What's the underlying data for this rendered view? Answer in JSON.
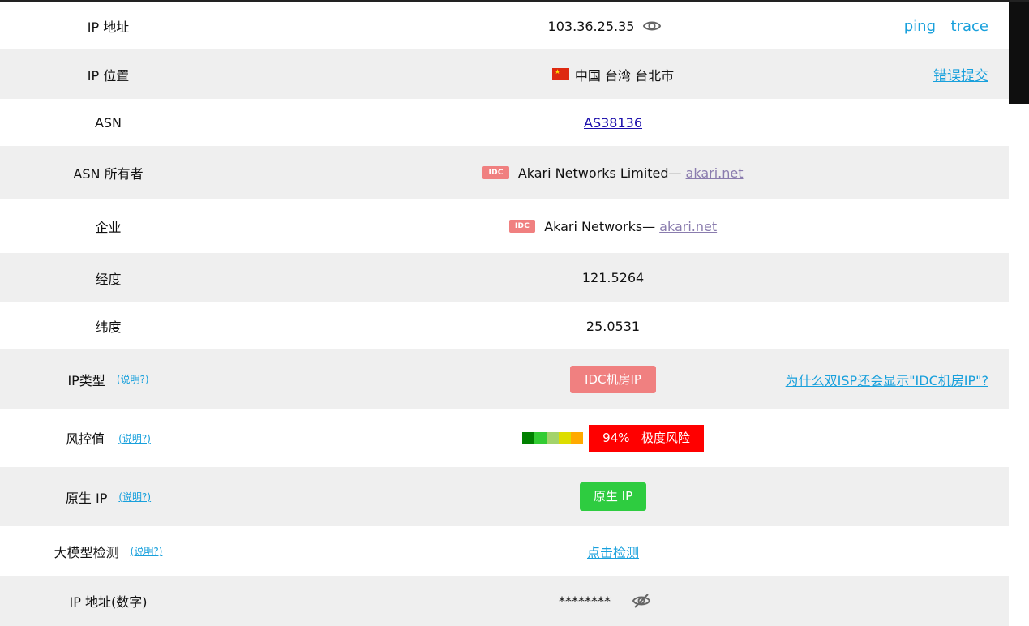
{
  "rows": {
    "ip": {
      "label": "IP 地址",
      "value": "103.36.25.35",
      "ping": "ping",
      "trace": "trace"
    },
    "location": {
      "label": "IP 位置",
      "value": "中国 台湾 台北市",
      "report": "错误提交"
    },
    "asn": {
      "label": "ASN",
      "value": "AS38136"
    },
    "asn_owner": {
      "label": "ASN 所有者",
      "tag": "IDC",
      "name": "Akari Networks Limited—",
      "domain": "akari.net"
    },
    "company": {
      "label": "企业",
      "tag": "IDC",
      "name": "Akari Networks—",
      "domain": "akari.net"
    },
    "longitude": {
      "label": "经度",
      "value": "121.5264"
    },
    "latitude": {
      "label": "纬度",
      "value": "25.0531"
    },
    "ip_type": {
      "label": "IP类型",
      "help": "(说明?)",
      "badge": "IDC机房IP",
      "question": "为什么双ISP还会显示\"IDC机房IP\"?"
    },
    "risk": {
      "label": "风控值",
      "help": "(说明?)",
      "score": "94%",
      "level": "极度风险",
      "score_value": 94,
      "bar_colors": [
        "#008000",
        "#33cc33",
        "#a3d36b",
        "#dddd00",
        "#ffaa00"
      ]
    },
    "native": {
      "label": "原生 IP",
      "help": "(说明?)",
      "badge": "原生 IP"
    },
    "llm": {
      "label": "大模型检测",
      "help": "(说明?)",
      "link": "点击检测"
    },
    "ip_num": {
      "label": "IP 地址(数字)",
      "value": "********"
    }
  },
  "colors": {
    "accent": "#18a0dc",
    "idc": "#f08080",
    "danger": "#ff0000",
    "native": "#2ecc40"
  },
  "icons": {
    "eye": "eye-icon",
    "eye_off": "eye-off-icon",
    "flag": "china-flag-icon"
  }
}
